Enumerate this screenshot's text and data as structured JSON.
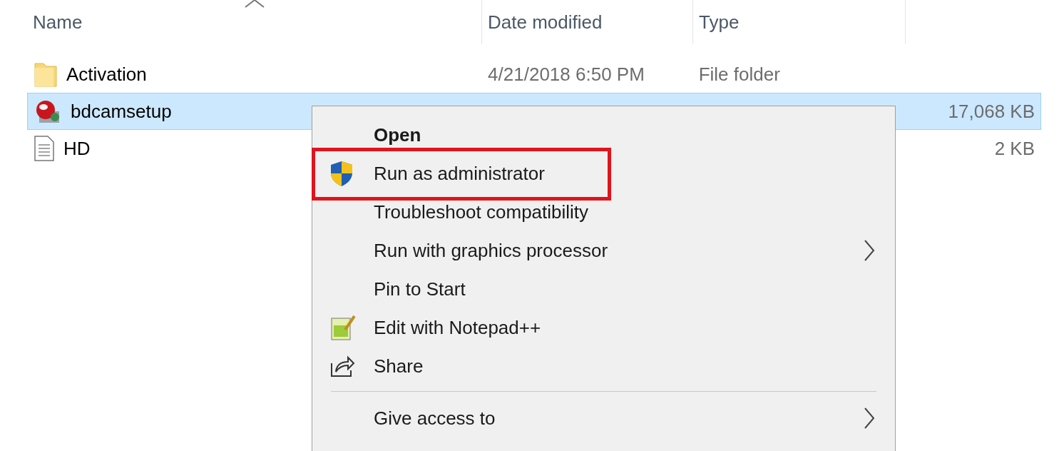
{
  "columns": [
    {
      "label": "Name",
      "sorted": true
    },
    {
      "label": "Date modified",
      "sorted": false
    },
    {
      "label": "Type",
      "sorted": false
    }
  ],
  "rows": [
    {
      "kind": "folder",
      "name": "Activation",
      "date": "4/21/2018 6:50 PM",
      "type": "File folder",
      "selected": false
    },
    {
      "kind": "application",
      "name": "bdcamsetup",
      "size": "17,068 KB",
      "selected": true
    },
    {
      "kind": "document",
      "name": "HD",
      "size": "2 KB",
      "selected": false
    }
  ],
  "context_menu": {
    "items": [
      {
        "kind": "plain",
        "label": "Open",
        "default": true,
        "submenu": false,
        "highlighted": false
      },
      {
        "kind": "shield",
        "label": "Run as administrator",
        "default": false,
        "submenu": false,
        "highlighted": true
      },
      {
        "kind": "plain",
        "label": "Troubleshoot compatibility",
        "default": false,
        "submenu": false,
        "highlighted": false
      },
      {
        "kind": "plain",
        "label": "Run with graphics processor",
        "default": false,
        "submenu": true,
        "highlighted": false
      },
      {
        "kind": "plain",
        "label": "Pin to Start",
        "default": false,
        "submenu": false,
        "highlighted": false
      },
      {
        "kind": "notepad",
        "label": "Edit with Notepad++",
        "default": false,
        "submenu": false,
        "highlighted": false
      },
      {
        "kind": "share",
        "label": "Share",
        "default": false,
        "submenu": false,
        "highlighted": false
      },
      {
        "kind": "separator"
      },
      {
        "kind": "plain",
        "label": "Give access to",
        "default": false,
        "submenu": true,
        "highlighted": false
      }
    ]
  }
}
